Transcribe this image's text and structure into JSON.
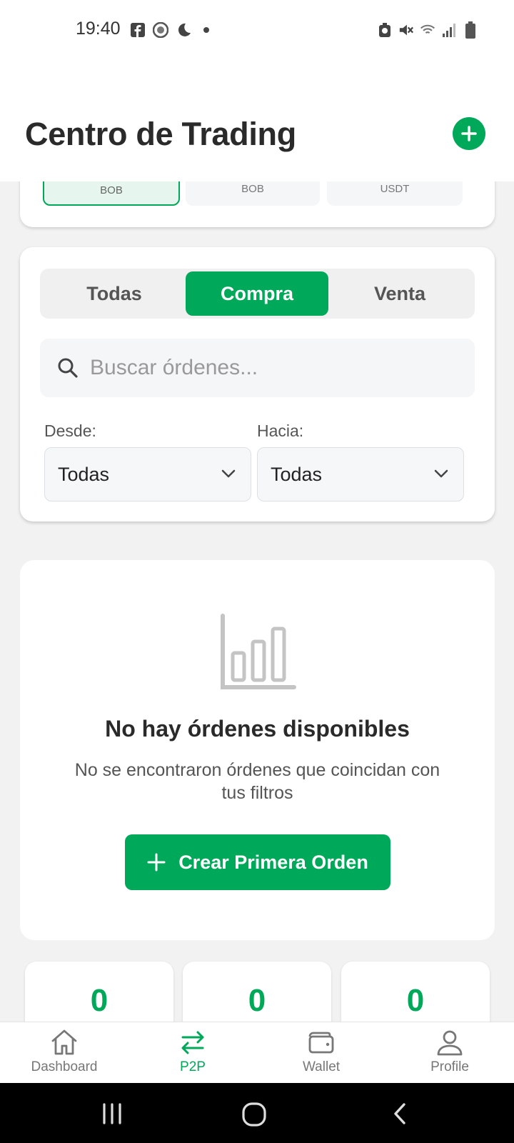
{
  "status_bar": {
    "time": "19:40",
    "left_icons": [
      "facebook-icon",
      "app-icon",
      "moon-icon",
      "dot-icon"
    ],
    "right_icons": [
      "alarm-icon",
      "mute-icon",
      "wifi-icon",
      "signal-icon",
      "battery-icon"
    ]
  },
  "header": {
    "title": "Centro de Trading",
    "add_icon": "plus-icon"
  },
  "currency_chips": [
    {
      "label": "BOB",
      "active": true
    },
    {
      "label": "BOB",
      "active": false
    },
    {
      "label": "USDT",
      "active": false
    }
  ],
  "filters": {
    "tabs": [
      {
        "label": "Todas",
        "active": false
      },
      {
        "label": "Compra",
        "active": true
      },
      {
        "label": "Venta",
        "active": false
      }
    ],
    "search_placeholder": "Buscar órdenes...",
    "search_value": "",
    "from_label": "Desde:",
    "to_label": "Hacia:",
    "from_value": "Todas",
    "to_value": "Todas"
  },
  "empty_state": {
    "icon": "bar-chart-icon",
    "title": "No hay órdenes disponibles",
    "subtitle": "No se encontraron órdenes que coincidan con tus filtros",
    "button_label": "Crear Primera Orden"
  },
  "stats": [
    {
      "value": "0"
    },
    {
      "value": "0"
    },
    {
      "value": "0"
    }
  ],
  "bottom_nav": [
    {
      "label": "Dashboard",
      "icon": "home-icon",
      "active": false
    },
    {
      "label": "P2P",
      "icon": "swap-icon",
      "active": true
    },
    {
      "label": "Wallet",
      "icon": "wallet-icon",
      "active": false
    },
    {
      "label": "Profile",
      "icon": "user-icon",
      "active": false
    }
  ],
  "colors": {
    "accent": "#00a859",
    "background": "#f2f2f2",
    "card": "#ffffff"
  }
}
